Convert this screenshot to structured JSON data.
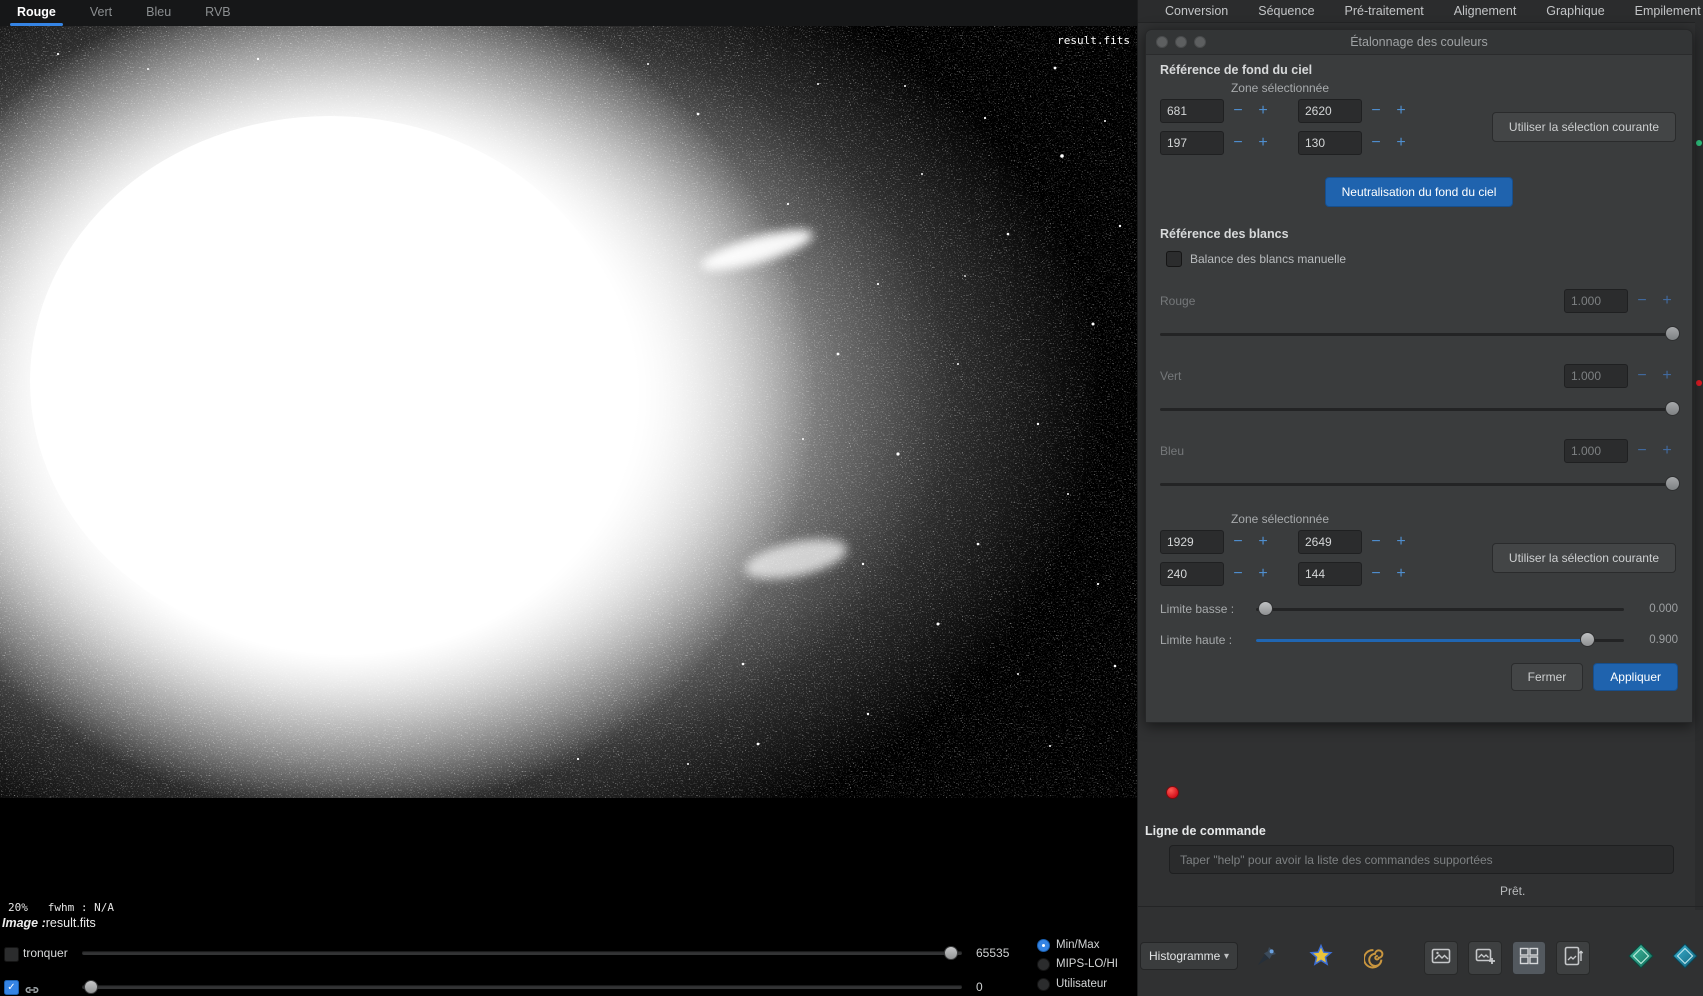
{
  "colors": {
    "accent": "#3584e4",
    "button_blue": "#1f63ae",
    "record_red": "#e01b24",
    "strip_green": "#2ec27e"
  },
  "viewer": {
    "tabs": [
      "Rouge",
      "Vert",
      "Bleu",
      "RVB"
    ],
    "active_tab": "Rouge",
    "overlay_filename": "result.fits",
    "status_line": "20%   fwhm : N/A",
    "image_label_prefix": "Image :",
    "image_name": "result.fits"
  },
  "bottom_bar": {
    "truncate_label": "tronquer",
    "high_value": "65535",
    "low_value": "0",
    "modes": [
      "Min/Max",
      "MIPS-LO/HI",
      "Utilisateur"
    ],
    "selected_mode": "Min/Max",
    "display_mode": "Histogramme",
    "caret": "▾",
    "check": "✓"
  },
  "menu": {
    "items": [
      "Conversion",
      "Séquence",
      "Pré-traitement",
      "Alignement",
      "Graphique",
      "Empilement"
    ]
  },
  "dialog": {
    "title": "Étalonnage des couleurs",
    "bg": {
      "heading": "Référence de fond du ciel",
      "zone_label": "Zone sélectionnée",
      "x": "681",
      "y": "2620",
      "w": "197",
      "h": "130",
      "use_selection": "Utiliser la sélection courante",
      "neutralize": "Neutralisation du fond du ciel"
    },
    "white": {
      "heading": "Référence des blancs",
      "manual_label": "Balance des blancs manuelle",
      "channels": [
        {
          "label": "Rouge",
          "value": "1.000"
        },
        {
          "label": "Vert",
          "value": "1.000"
        },
        {
          "label": "Bleu",
          "value": "1.000"
        }
      ],
      "zone_label": "Zone sélectionnée",
      "x": "1929",
      "y": "2649",
      "w": "240",
      "h": "144",
      "use_selection": "Utiliser la sélection courante",
      "low_label": "Limite basse :",
      "low_value": "0.000",
      "high_label": "Limite haute :",
      "high_value": "0.900"
    },
    "minus": "−",
    "plus": "+",
    "close_label": "Fermer",
    "apply_label": "Appliquer"
  },
  "console": {
    "heading": "Ligne de commande",
    "placeholder": "Taper \"help\" pour avoir la liste des commandes supportées",
    "status": "Prêt."
  }
}
